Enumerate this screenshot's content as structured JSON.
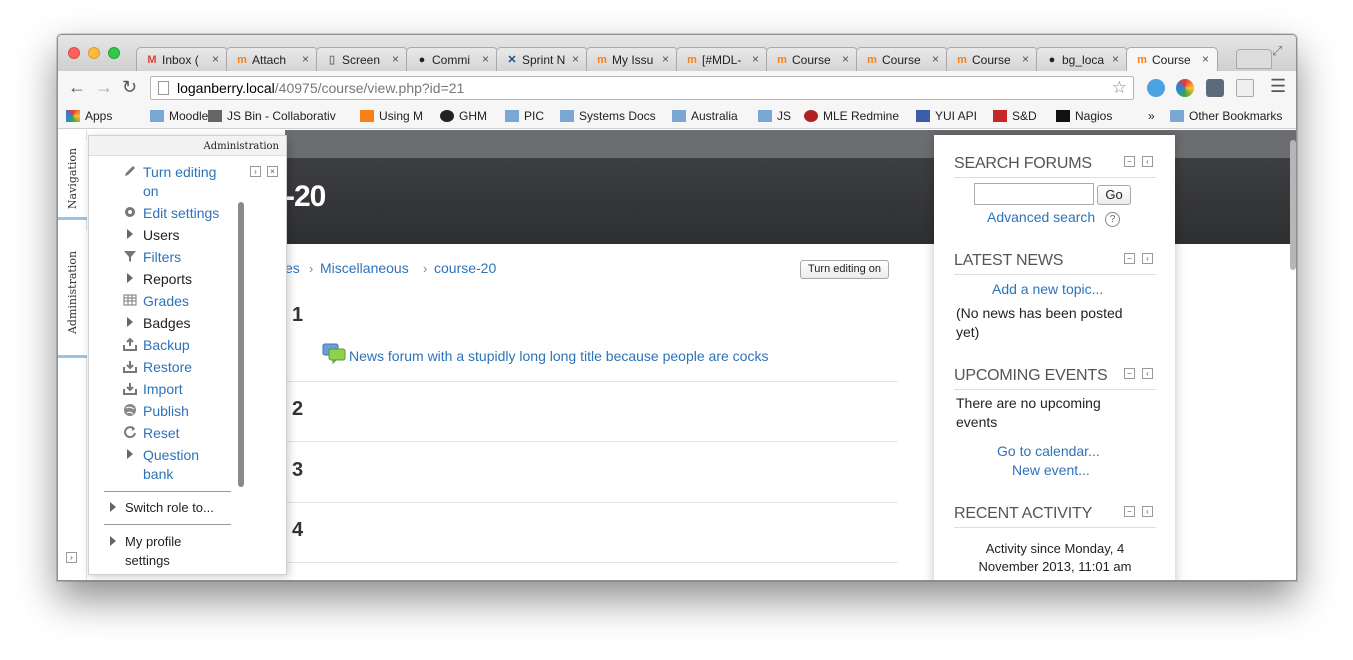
{
  "browser": {
    "tabs": [
      {
        "icon": "gmail-icon",
        "title": "Inbox (",
        "active": false
      },
      {
        "icon": "moodle-icon",
        "title": "Attach",
        "active": false
      },
      {
        "icon": "page-icon",
        "title": "Screen",
        "active": false
      },
      {
        "icon": "github-icon",
        "title": "Commi",
        "active": false
      },
      {
        "icon": "jira-icon",
        "title": "Sprint N",
        "active": false
      },
      {
        "icon": "moodle-icon",
        "title": "My Issu",
        "active": false
      },
      {
        "icon": "moodle-icon",
        "title": "[#MDL-",
        "active": false
      },
      {
        "icon": "moodle-course-icon",
        "title": "Course",
        "active": false
      },
      {
        "icon": "moodle-course-icon",
        "title": "Course",
        "active": false
      },
      {
        "icon": "moodle-course-icon",
        "title": "Course",
        "active": false
      },
      {
        "icon": "github-icon",
        "title": "bg_loca",
        "active": false
      },
      {
        "icon": "moodle-course-icon",
        "title": "Course",
        "active": true
      }
    ],
    "url_host": "loganberry.local",
    "url_path": "/40975/course/view.php?id=21",
    "bookmarks": [
      {
        "icon": "apps-icon",
        "label": "Apps"
      },
      {
        "icon": "folder-icon",
        "label": "Moodle"
      },
      {
        "icon": "jsbin-icon",
        "label": "JS Bin - Collaborativ"
      },
      {
        "icon": "moodle-course-icon",
        "label": "Using M"
      },
      {
        "icon": "github-icon",
        "label": "GHM"
      },
      {
        "icon": "folder-icon",
        "label": "PIC"
      },
      {
        "icon": "folder-icon",
        "label": "Systems Docs"
      },
      {
        "icon": "folder-icon",
        "label": "Australia"
      },
      {
        "icon": "folder-icon",
        "label": "JS"
      },
      {
        "icon": "redmine-icon",
        "label": "MLE Redmine"
      },
      {
        "icon": "yui-icon",
        "label": "YUI API"
      },
      {
        "icon": "sd-icon",
        "label": "S&D"
      },
      {
        "icon": "nagios-icon",
        "label": "Nagios"
      }
    ],
    "overflow_label": "»",
    "other_bookmarks": "Other Bookmarks"
  },
  "dock": {
    "navigation": "Navigation",
    "administration": "Administration"
  },
  "admin": {
    "header": "Administration",
    "turn_editing_1": "Turn editing",
    "turn_editing_2": "on",
    "edit_settings": "Edit settings",
    "users": "Users",
    "filters": "Filters",
    "reports": "Reports",
    "grades": "Grades",
    "badges": "Badges",
    "backup": "Backup",
    "restore": "Restore",
    "import": "Import",
    "publish": "Publish",
    "reset": "Reset",
    "question_bank_1": "Question",
    "question_bank_2": "bank",
    "switch_role": "Switch role to...",
    "my_profile_1": "My profile",
    "my_profile_2": "settings"
  },
  "course": {
    "title_visible": "-20",
    "breadcrumb": [
      "es",
      "Miscellaneous",
      "course-20"
    ],
    "turn_editing_button": "Turn editing on",
    "sections": [
      "1",
      "2",
      "3",
      "4"
    ],
    "news_forum": "News forum with a stupidly long long title because people are cocks"
  },
  "blocks": {
    "search_forums": {
      "title": "SEARCH FORUMS",
      "go": "Go",
      "advanced": "Advanced search",
      "help": "?"
    },
    "latest_news": {
      "title": "LATEST NEWS",
      "add_topic": "Add a new topic...",
      "empty_1": "(No news has been posted",
      "empty_2": "yet)"
    },
    "upcoming_events": {
      "title": "UPCOMING EVENTS",
      "empty_1": "There are no upcoming",
      "empty_2": "events",
      "calendar": "Go to calendar...",
      "new_event": "New event..."
    },
    "recent_activity": {
      "title": "RECENT ACTIVITY",
      "since_1": "Activity since Monday, 4",
      "since_2": "November 2013, 11:01 am"
    }
  },
  "colors": {
    "link": "#2d73b9",
    "header_dark": "#333437",
    "dock_accent": "#9cc2e6"
  }
}
